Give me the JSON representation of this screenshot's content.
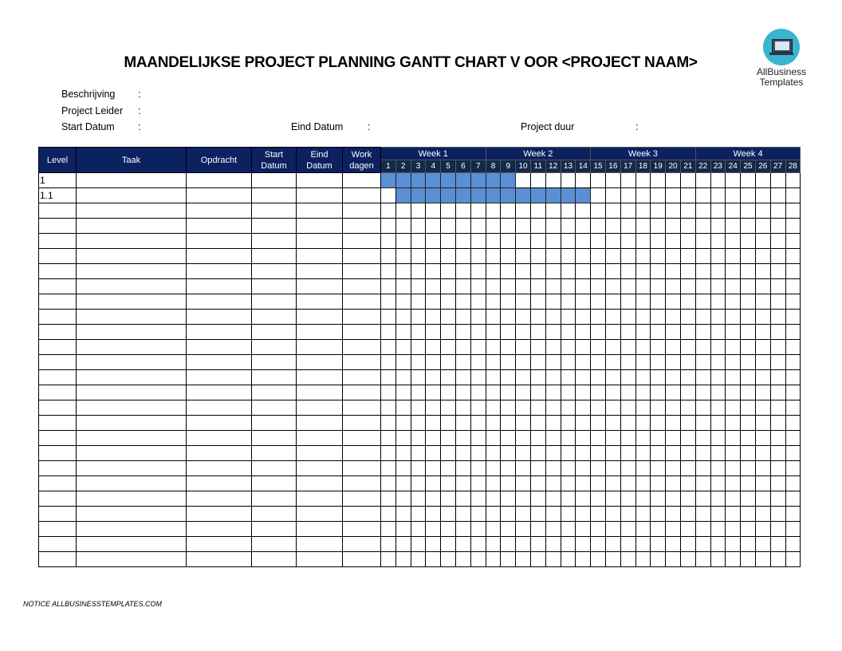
{
  "title": "MAANDELIJKSE PROJECT PLANNING GANTT CHART V OOR <PROJECT NAAM>",
  "logo": {
    "icon": "laptop-icon",
    "line1": "AllBusiness",
    "line2": "Templates"
  },
  "info": {
    "beschrijving": "Beschrijving",
    "project_leider": "Project Leider",
    "start_datum": "Start Datum",
    "eind_datum": "Eind Datum",
    "project_duur": "Project duur",
    "colon": ":"
  },
  "table": {
    "headers": {
      "level": "Level",
      "taak": "Taak",
      "opdracht": "Opdracht",
      "start_1": "Start",
      "start_2": "Datum",
      "eind_1": "Eind",
      "eind_2": "Datum",
      "work_1": "Work",
      "work_2": "dagen"
    },
    "weeks": [
      "Week 1",
      "Week 2",
      "Week 3",
      "Week 4"
    ],
    "days": [
      1,
      2,
      3,
      4,
      5,
      6,
      7,
      8,
      9,
      10,
      11,
      12,
      13,
      14,
      15,
      16,
      17,
      18,
      19,
      20,
      21,
      22,
      23,
      24,
      25,
      26,
      27,
      28
    ],
    "row_count": 26,
    "rows": [
      {
        "level": "1",
        "taak": "",
        "opdracht": "",
        "start": "",
        "eind": "",
        "workdagen": "",
        "bar_start_day": 1,
        "bar_end_day": 9
      },
      {
        "level": "1.1",
        "taak": "",
        "opdracht": "",
        "start": "",
        "eind": "",
        "workdagen": "",
        "bar_start_day": 2,
        "bar_end_day": 14
      }
    ],
    "bar_color": "#5b8fd4",
    "header_color": "#0b2160"
  },
  "notice": "NOTICE ALLBUSINESSTEMPLATES.COM"
}
